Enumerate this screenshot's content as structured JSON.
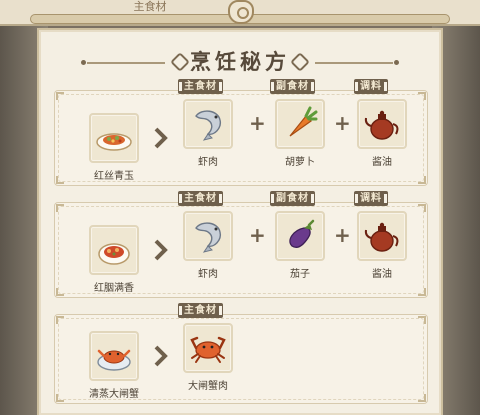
{
  "header": {
    "top_tab_label": "主食材",
    "title": "烹饪秘方"
  },
  "recipes": [
    {
      "dish": "红丝青玉",
      "main_tag": "主食材",
      "main": "虾肉",
      "side_tag": "副食材",
      "side": "胡萝卜",
      "seasoning_tag": "调料",
      "seasoning": "酱油"
    },
    {
      "dish": "红胭满香",
      "main_tag": "主食材",
      "main": "虾肉",
      "side_tag": "副食材",
      "side": "茄子",
      "seasoning_tag": "调料",
      "seasoning": "酱油"
    },
    {
      "dish": "清蒸大闸蟹",
      "main_tag": "主食材",
      "main": "大闸蟹肉"
    }
  ],
  "icons": {
    "dish_1": "stir-fry-plate-icon",
    "dish_2": "red-dish-bowl-icon",
    "dish_3": "steamed-crab-bowl-icon",
    "shrimp": "shrimp-icon",
    "carrot": "carrot-icon",
    "eggplant": "eggplant-icon",
    "soy_sauce": "soy-sauce-pot-icon",
    "crab": "crab-icon"
  },
  "colors": {
    "panel_bg": "#f4efe3",
    "tag_bg": "#6f604c",
    "title_text": "#574a3b"
  }
}
